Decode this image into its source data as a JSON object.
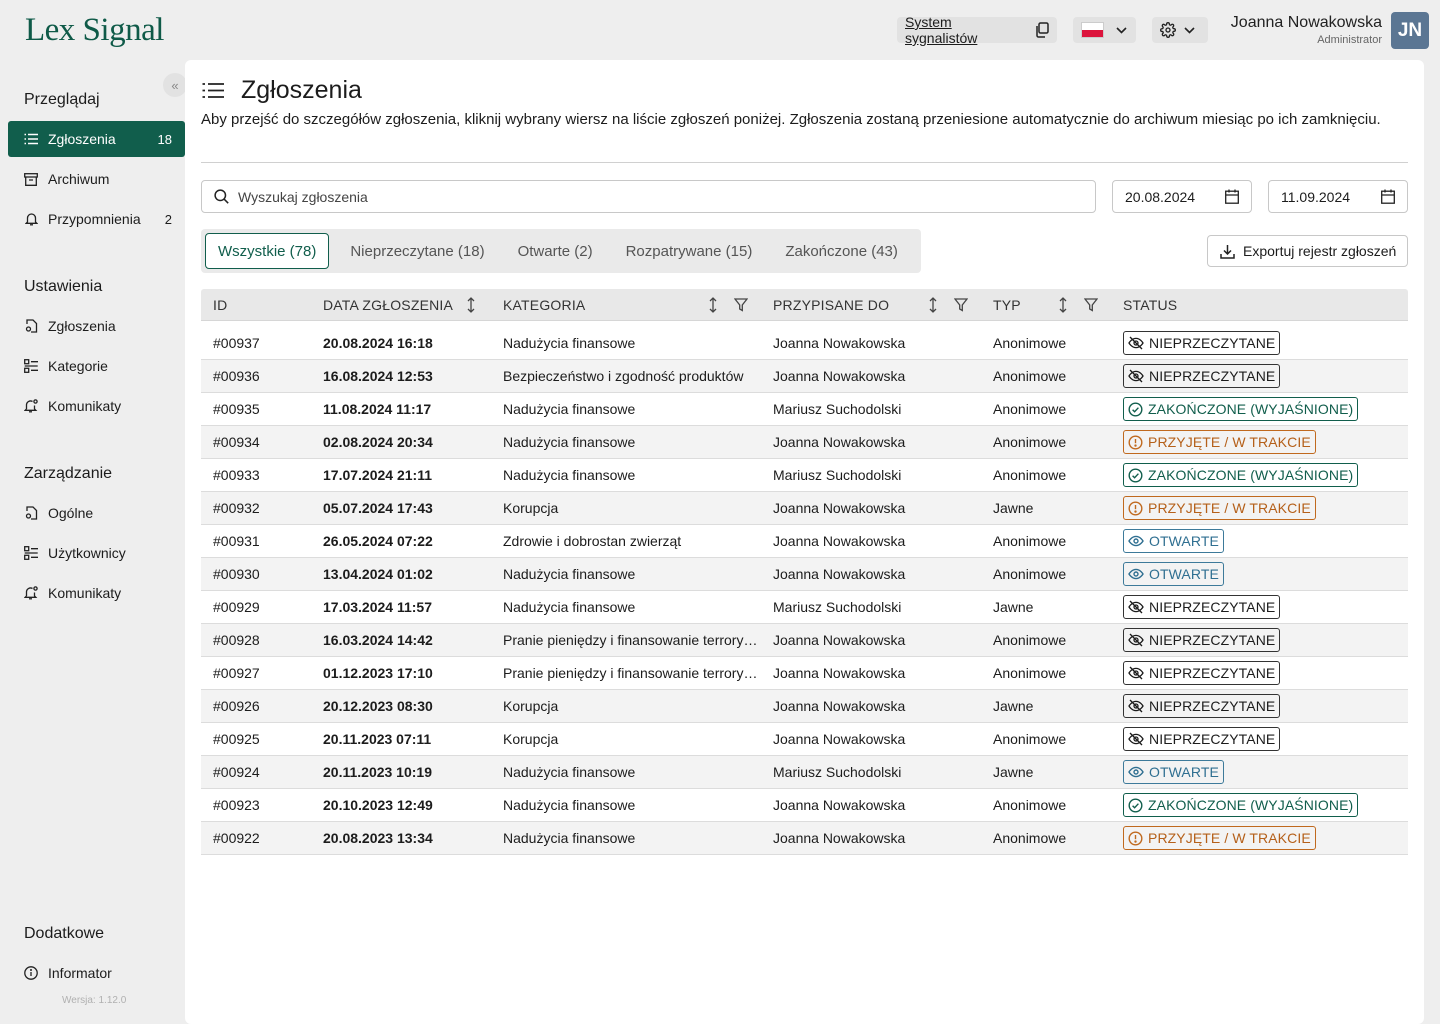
{
  "app": {
    "logo": "Lex Signal",
    "system_link": "System sygnalistów",
    "user_name": "Joanna Nowakowska",
    "user_role": "Administrator",
    "avatar": "JN"
  },
  "sidebar": {
    "collapse": "«",
    "sections": [
      {
        "title": "Przeglądaj"
      },
      {
        "title": "Ustawienia"
      },
      {
        "title": "Zarządzanie"
      },
      {
        "title": "Dodatkowe"
      }
    ],
    "items": [
      {
        "label": "Zgłoszenia",
        "count": "18",
        "icon": "list-icon"
      },
      {
        "label": "Archiwum",
        "count": "",
        "icon": "archive-icon"
      },
      {
        "label": "Przypomnienia",
        "count": "2",
        "icon": "bell-icon"
      },
      {
        "label": "Zgłoszenia",
        "icon": "document-settings-icon"
      },
      {
        "label": "Kategorie",
        "icon": "categories-icon"
      },
      {
        "label": "Komunikaty",
        "icon": "bell-settings-icon"
      },
      {
        "label": "Ogólne",
        "icon": "document-settings-icon"
      },
      {
        "label": "Użytkownicy",
        "icon": "users-list-icon"
      },
      {
        "label": "Komunikaty",
        "icon": "bell-settings-icon"
      },
      {
        "label": "Informator",
        "icon": "info-icon"
      }
    ],
    "version": "Wersja: 1.12.0"
  },
  "main": {
    "title": "Zgłoszenia",
    "description": "Aby przejść do szczegółów zgłoszenia, kliknij wybrany wiersz na liście zgłoszeń poniżej. Zgłoszenia zostaną przeniesione automatycznie do archiwum miesiąc po ich zamknięciu.",
    "search_placeholder": "Wyszukaj zgłoszenia",
    "date_from": "20.08.2024",
    "date_to": "11.09.2024",
    "tabs": [
      "Wszystkie (78)",
      "Nieprzeczytane (18)",
      "Otwarte (2)",
      "Rozpatrywane (15)",
      "Zakończone (43)"
    ],
    "export_label": "Exportuj rejestr zgłoszeń"
  },
  "table": {
    "headers": {
      "id": "ID",
      "date": "DATA ZGŁOSZENIA",
      "category": "KATEGORIA",
      "assigned": "PRZYPISANE DO",
      "type": "TYP",
      "status": "STATUS"
    },
    "status_labels": {
      "unread": "NIEPRZECZYTANE",
      "closed": "ZAKOŃCZONE (WYJAŚNIONE)",
      "progress": "PRZYJĘTE / W TRAKCIE",
      "open": "OTWARTE"
    },
    "rows": [
      {
        "id": "#00937",
        "date": "20.08.2024 16:18",
        "category": "Nadużycia finansowe",
        "assigned": "Joanna Nowakowska",
        "type": "Anonimowe",
        "status": "unread"
      },
      {
        "id": "#00936",
        "date": "16.08.2024 12:53",
        "category": "Bezpieczeństwo i zgodność produktów",
        "assigned": "Joanna Nowakowska",
        "type": "Anonimowe",
        "status": "unread"
      },
      {
        "id": "#00935",
        "date": "11.08.2024 11:17",
        "category": "Nadużycia finansowe",
        "assigned": "Mariusz Suchodolski",
        "type": "Anonimowe",
        "status": "closed"
      },
      {
        "id": "#00934",
        "date": "02.08.2024 20:34",
        "category": "Nadużycia finansowe",
        "assigned": "Joanna Nowakowska",
        "type": "Anonimowe",
        "status": "progress"
      },
      {
        "id": "#00933",
        "date": "17.07.2024 21:11",
        "category": "Nadużycia finansowe",
        "assigned": "Mariusz Suchodolski",
        "type": "Anonimowe",
        "status": "closed"
      },
      {
        "id": "#00932",
        "date": "05.07.2024 17:43",
        "category": "Korupcja",
        "assigned": "Joanna Nowakowska",
        "type": "Jawne",
        "status": "progress"
      },
      {
        "id": "#00931",
        "date": "26.05.2024 07:22",
        "category": "Zdrowie i dobrostan zwierząt",
        "assigned": "Joanna Nowakowska",
        "type": "Anonimowe",
        "status": "open"
      },
      {
        "id": "#00930",
        "date": "13.04.2024 01:02",
        "category": "Nadużycia finansowe",
        "assigned": "Joanna Nowakowska",
        "type": "Anonimowe",
        "status": "open"
      },
      {
        "id": "#00929",
        "date": "17.03.2024 11:57",
        "category": "Nadużycia finansowe",
        "assigned": "Mariusz Suchodolski",
        "type": "Jawne",
        "status": "unread"
      },
      {
        "id": "#00928",
        "date": "16.03.2024 14:42",
        "category": "Pranie pieniędzy i finansowanie terrory…",
        "assigned": "Joanna Nowakowska",
        "type": "Anonimowe",
        "status": "unread"
      },
      {
        "id": "#00927",
        "date": "01.12.2023 17:10",
        "category": "Pranie pieniędzy i finansowanie terrory…",
        "assigned": "Joanna Nowakowska",
        "type": "Anonimowe",
        "status": "unread"
      },
      {
        "id": "#00926",
        "date": "20.12.2023 08:30",
        "category": "Korupcja",
        "assigned": "Joanna Nowakowska",
        "type": "Jawne",
        "status": "unread"
      },
      {
        "id": "#00925",
        "date": "20.11.2023 07:11",
        "category": "Korupcja",
        "assigned": "Joanna Nowakowska",
        "type": "Anonimowe",
        "status": "unread"
      },
      {
        "id": "#00924",
        "date": "20.11.2023 10:19",
        "category": "Nadużycia finansowe",
        "assigned": "Mariusz Suchodolski",
        "type": "Jawne",
        "status": "open"
      },
      {
        "id": "#00923",
        "date": "20.10.2023 12:49",
        "category": "Nadużycia finansowe",
        "assigned": "Joanna Nowakowska",
        "type": "Anonimowe",
        "status": "closed"
      },
      {
        "id": "#00922",
        "date": "20.08.2023 13:34",
        "category": "Nadużycia finansowe",
        "assigned": "Joanna Nowakowska",
        "type": "Anonimowe",
        "status": "progress"
      }
    ]
  },
  "colors": {
    "brand": "#115e4c",
    "closed": "#115e4c",
    "progress": "#c0691e",
    "open": "#3d7a9a",
    "avatar": "#5b7693"
  }
}
